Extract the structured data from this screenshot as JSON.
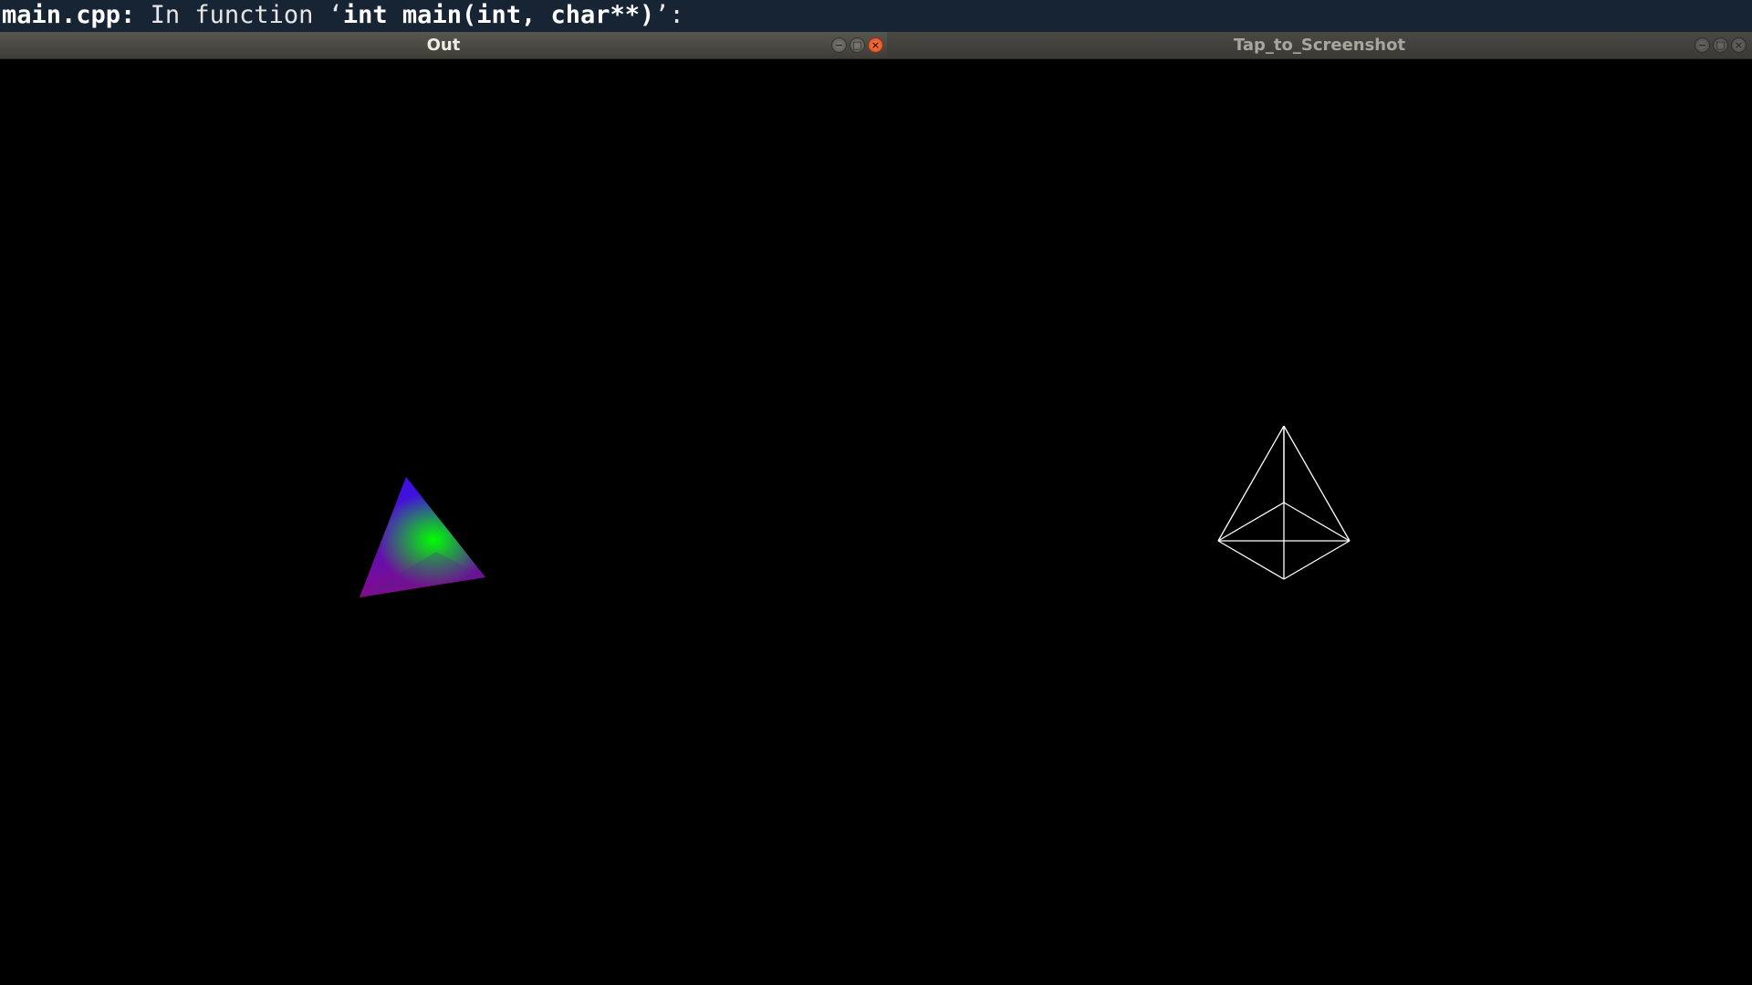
{
  "terminal": {
    "file": "main.cpp:",
    "text": " In function ",
    "open_quote": "‘",
    "signature": "int main(int, char**)",
    "close_quote": "’:"
  },
  "windows": [
    {
      "title": "Out",
      "active": true
    },
    {
      "title": "Tap_to_Screenshot",
      "active": false
    }
  ],
  "controls": {
    "minimize": "−",
    "maximize": "□",
    "close": "×"
  },
  "colors": {
    "terminal_bg": "#172434",
    "titlebar_active": "#58574f",
    "close_active": "#e95420",
    "tetra_red": "#ff0000",
    "tetra_green": "#00ff00",
    "tetra_blue": "#0000ff",
    "wireframe": "#ffffff"
  },
  "icons": [
    "minimize-icon",
    "maximize-icon",
    "close-icon"
  ]
}
